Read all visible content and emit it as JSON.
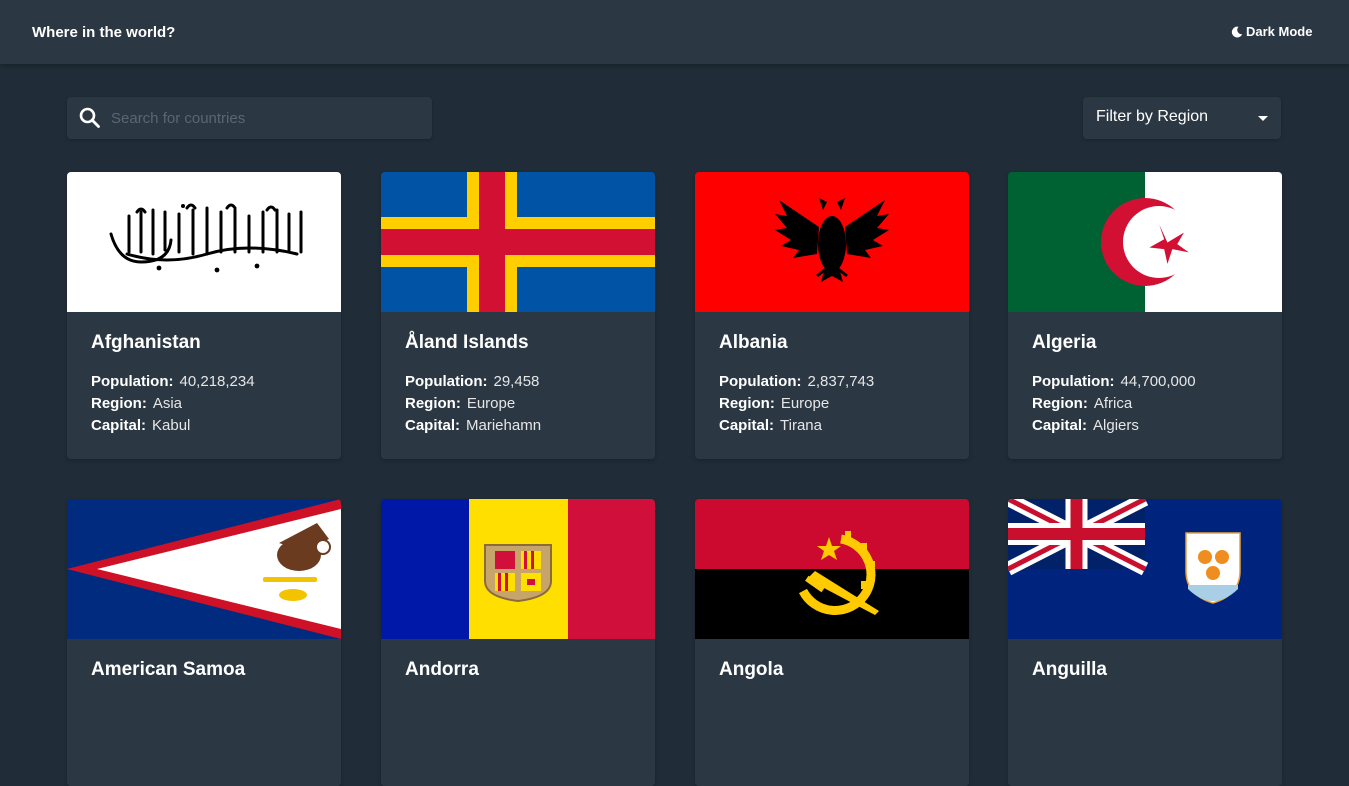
{
  "header": {
    "title": "Where in the world?",
    "mode_label": "Dark Mode"
  },
  "search": {
    "placeholder": "Search for countries",
    "value": ""
  },
  "filter": {
    "label": "Filter by Region"
  },
  "labels": {
    "population": "Population:",
    "region": "Region:",
    "capital": "Capital:"
  },
  "countries": [
    {
      "name": "Afghanistan",
      "population": "40,218,234",
      "region": "Asia",
      "capital": "Kabul"
    },
    {
      "name": "Åland Islands",
      "population": "29,458",
      "region": "Europe",
      "capital": "Mariehamn"
    },
    {
      "name": "Albania",
      "population": "2,837,743",
      "region": "Europe",
      "capital": "Tirana"
    },
    {
      "name": "Algeria",
      "population": "44,700,000",
      "region": "Africa",
      "capital": "Algiers"
    },
    {
      "name": "American Samoa"
    },
    {
      "name": "Andorra"
    },
    {
      "name": "Angola"
    },
    {
      "name": "Anguilla"
    }
  ],
  "colors": {
    "background": "#202c37",
    "element": "#2b3743",
    "text": "#ffffff"
  }
}
